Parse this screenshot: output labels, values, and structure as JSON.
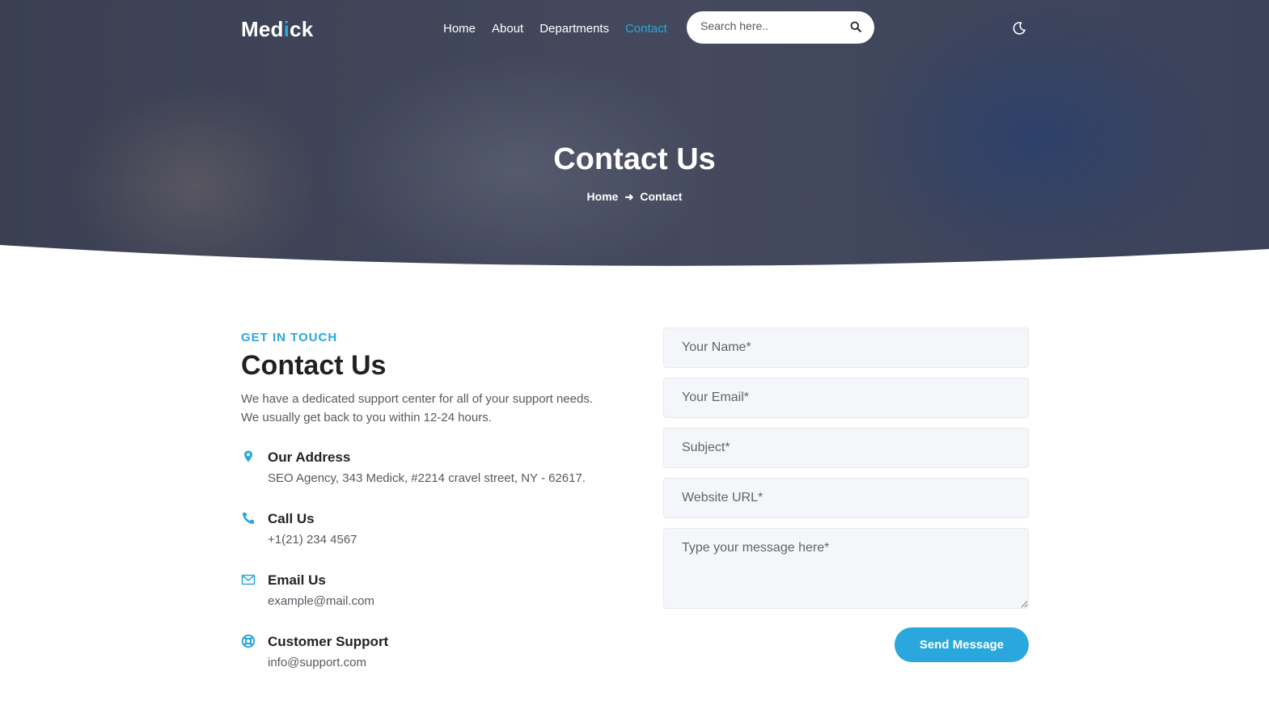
{
  "brand": {
    "logo_part1": "Med",
    "logo_accent": "i",
    "logo_part2": "ck",
    "accent_color": "#2aa7dd"
  },
  "nav": {
    "items": [
      {
        "label": "Home"
      },
      {
        "label": "About"
      },
      {
        "label": "Departments"
      },
      {
        "label": "Contact",
        "active": true
      }
    ]
  },
  "search": {
    "placeholder": "Search here.."
  },
  "hero": {
    "title": "Contact Us",
    "breadcrumb": {
      "home": "Home",
      "current": "Contact"
    }
  },
  "contact": {
    "eyebrow": "GET IN TOUCH",
    "title": "Contact Us",
    "description": "We have a dedicated support center for all of your support needs. We usually get back to you within 12-24 hours.",
    "items": [
      {
        "icon": "map-pin-icon",
        "title": "Our Address",
        "value": "SEO Agency, 343 Medick, #2214 cravel street, NY - 62617."
      },
      {
        "icon": "phone-icon",
        "title": "Call Us",
        "value": "+1(21) 234 4567"
      },
      {
        "icon": "envelope-icon",
        "title": "Email Us",
        "value": "example@mail.com"
      },
      {
        "icon": "lifebuoy-icon",
        "title": "Customer Support",
        "value": "info@support.com"
      }
    ]
  },
  "form": {
    "name_placeholder": "Your Name*",
    "email_placeholder": "Your Email*",
    "subject_placeholder": "Subject*",
    "website_placeholder": "Website URL*",
    "message_placeholder": "Type your message here*",
    "submit_label": "Send Message"
  }
}
